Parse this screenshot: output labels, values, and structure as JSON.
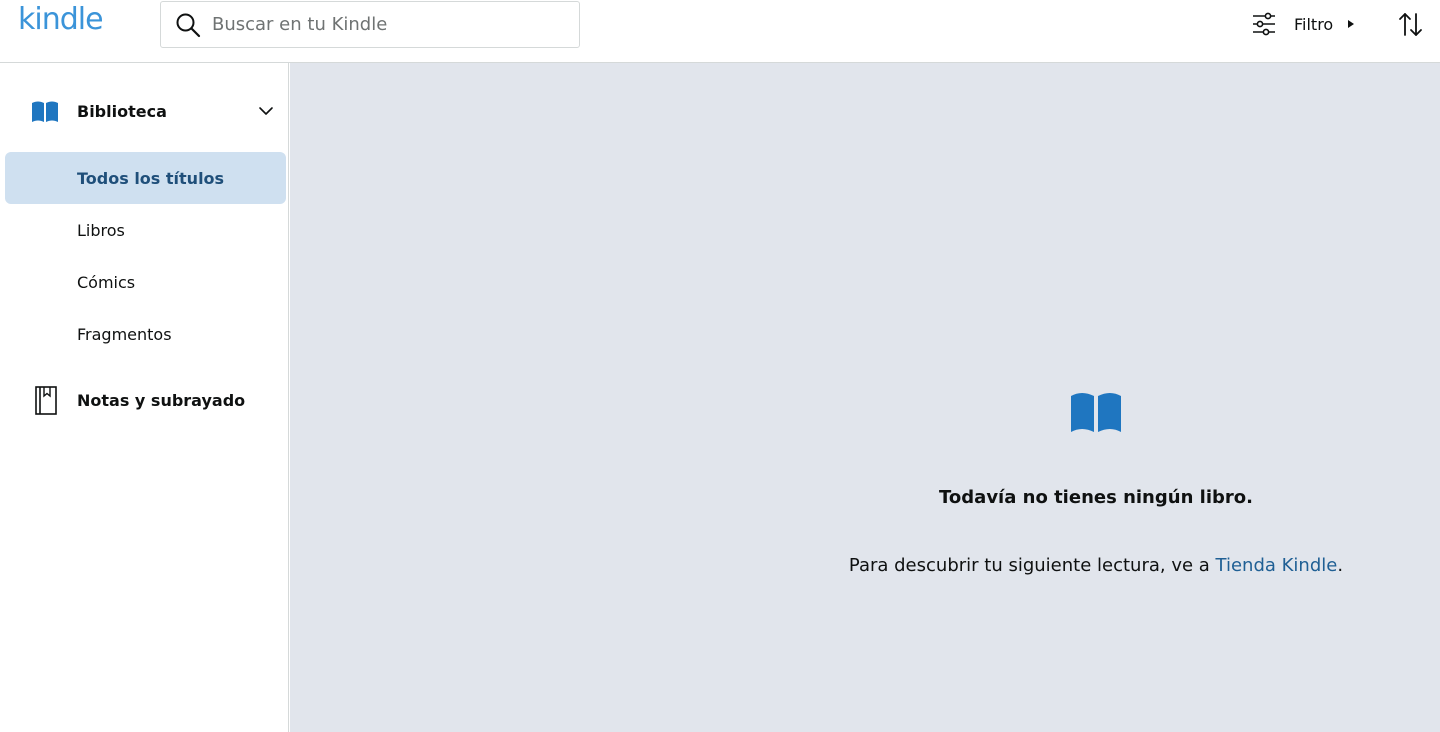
{
  "header": {
    "logo": "kindle",
    "search": {
      "placeholder": "Buscar en tu Kindle",
      "value": ""
    },
    "filter_label": "Filtro",
    "icons": {
      "search": "search-icon",
      "filter": "sliders-icon",
      "caret": "caret-right-icon",
      "sort": "sort-arrows-icon"
    }
  },
  "sidebar": {
    "library": {
      "label": "Biblioteca",
      "icon": "book-open-icon",
      "expanded": true
    },
    "items": [
      {
        "label": "Todos los títulos",
        "active": true
      },
      {
        "label": "Libros",
        "active": false
      },
      {
        "label": "Cómics",
        "active": false
      },
      {
        "label": "Fragmentos",
        "active": false
      }
    ],
    "notes": {
      "label": "Notas y subrayado",
      "icon": "notebook-icon"
    }
  },
  "main": {
    "empty_icon": "book-open-icon",
    "empty_title": "Todavía no tienes ningún libro.",
    "empty_text_prefix": "Para descubrir tu siguiente lectura, ve a ",
    "empty_link": "Tienda Kindle",
    "empty_text_suffix": "."
  },
  "colors": {
    "accent": "#1f76c0",
    "logo": "#3b94d9",
    "active_bg": "#cfe0f0",
    "active_text": "#1f4f7a",
    "main_bg": "#e1e5ec",
    "link": "#1f5f94"
  }
}
